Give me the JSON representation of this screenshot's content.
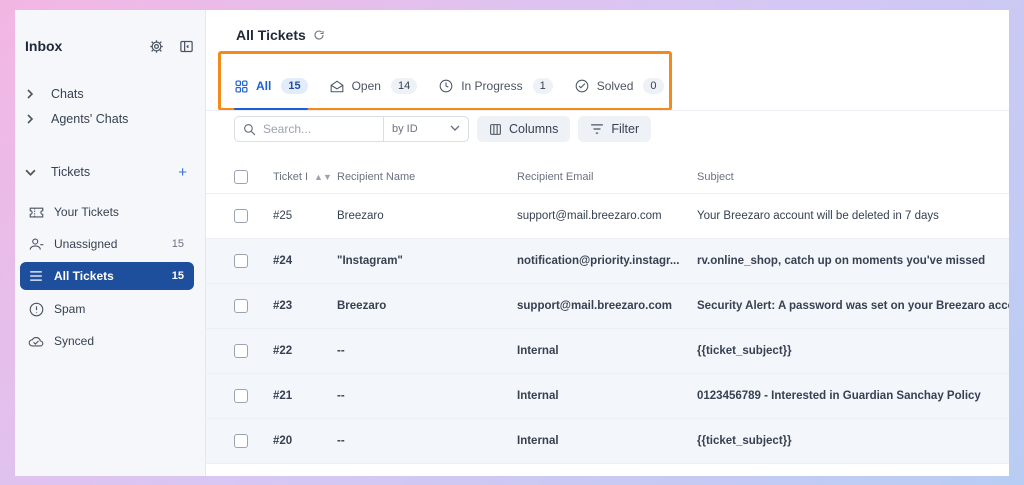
{
  "sidebar": {
    "title": "Inbox",
    "groups": [
      {
        "label": "Chats"
      },
      {
        "label": "Agents' Chats"
      }
    ],
    "tickets_label": "Tickets",
    "items": [
      {
        "label": "Your Tickets",
        "count": ""
      },
      {
        "label": "Unassigned",
        "count": "15"
      },
      {
        "label": "All Tickets",
        "count": "15"
      },
      {
        "label": "Spam",
        "count": ""
      },
      {
        "label": "Synced",
        "count": ""
      }
    ]
  },
  "main": {
    "title": "All Tickets",
    "tabs": [
      {
        "label": "All",
        "count": "15"
      },
      {
        "label": "Open",
        "count": "14"
      },
      {
        "label": "In Progress",
        "count": "1"
      },
      {
        "label": "Solved",
        "count": "0"
      }
    ],
    "search": {
      "placeholder": "Search...",
      "by": "by ID"
    },
    "columns_label": "Columns",
    "filter_label": "Filter",
    "table": {
      "headers": [
        "Ticket I",
        "Recipient Name",
        "Recipient Email",
        "Subject"
      ],
      "rows": [
        {
          "id": "#25",
          "name": "Breezaro",
          "email": "support@mail.breezaro.com",
          "subject": "Your Breezaro account will be deleted in 7 days"
        },
        {
          "id": "#24",
          "name": "\"Instagram\"",
          "email": "notification@priority.instagr...",
          "subject": "rv.online_shop, catch up on moments you've missed"
        },
        {
          "id": "#23",
          "name": "Breezaro",
          "email": "support@mail.breezaro.com",
          "subject": "Security Alert: A password was set on your Breezaro acco"
        },
        {
          "id": "#22",
          "name": "--",
          "email": "Internal",
          "subject": "{{ticket_subject}}"
        },
        {
          "id": "#21",
          "name": "--",
          "email": "Internal",
          "subject": "0123456789 - Interested in Guardian Sanchay Policy"
        },
        {
          "id": "#20",
          "name": "--",
          "email": "Internal",
          "subject": "{{ticket_subject}}"
        }
      ]
    }
  },
  "colors": {
    "accent": "#1d5fd6",
    "active_nav": "#1d4f9c",
    "highlight_box": "#f28a1c"
  },
  "icons": [
    "gear-icon",
    "collapse-panel-icon",
    "chevron-right-icon",
    "chevron-down-icon",
    "plus-icon",
    "ticket-icon",
    "user-icon",
    "list-icon",
    "alert-icon",
    "cloud-check-icon",
    "refresh-icon",
    "grid-icon",
    "envelope-open-icon",
    "clock-icon",
    "check-circle-icon",
    "search-icon",
    "columns-icon",
    "filter-icon",
    "sort-icon"
  ]
}
